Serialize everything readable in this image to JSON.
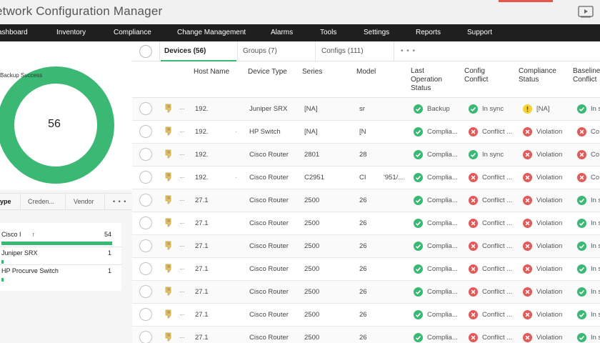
{
  "app": {
    "title": "etwork Configuration Manager",
    "accent": "#3bb873"
  },
  "nav": [
    "ashboard",
    "Inventory",
    "Compliance",
    "Change Management",
    "Alarms",
    "Tools",
    "Settings",
    "Reports",
    "Support"
  ],
  "donut": {
    "legend": "Backup Success",
    "value": "56",
    "color": "#3bb873"
  },
  "left_tabs": [
    "ype",
    "Creden...",
    "Vendor",
    "• • •"
  ],
  "vendors": [
    {
      "name": "Cisco I",
      "suffix": "r",
      "count": "54",
      "share": 1.0
    },
    {
      "name": "Juniper SRX",
      "count": "1",
      "share": 0.02
    },
    {
      "name": "HP Procurve Switch",
      "count": "1",
      "share": 0.02
    }
  ],
  "tabs": [
    {
      "label": "Devices (56)"
    },
    {
      "label": "Groups (7)"
    },
    {
      "label": "Configs (111)"
    },
    {
      "label": "• • •"
    }
  ],
  "columns": {
    "host": "Host Name",
    "device_type": "Device Type",
    "series": "Series",
    "model": "Model",
    "last_op_1": "Last",
    "last_op_2": "Operation",
    "last_op_3": "Status",
    "config_1": "Config",
    "config_2": "Conflict",
    "compliance_1": "Compliance",
    "compliance_2": "Status",
    "baseline_1": "Baseline",
    "baseline_2": "Conflict"
  },
  "rows": [
    {
      "dots": "...",
      "host": "192.",
      "extra": "",
      "type": "Juniper SRX",
      "series": "[NA]",
      "model": "sr",
      "model_extra": "",
      "op": {
        "s": "ok",
        "t": "Backup"
      },
      "conf": {
        "s": "ok",
        "t": "In sync"
      },
      "comp": {
        "s": "warn",
        "t": "[NA]"
      },
      "base": {
        "s": "ok",
        "t": "In s"
      }
    },
    {
      "dots": "...",
      "host": "192.",
      "extra": "·",
      "type": "HP Switch",
      "series": "[NA]",
      "model": "[N",
      "model_extra": "",
      "op": {
        "s": "ok",
        "t": "Complia..."
      },
      "conf": {
        "s": "bad",
        "t": "Conflict ..."
      },
      "comp": {
        "s": "bad",
        "t": "Violation"
      },
      "base": {
        "s": "bad",
        "t": "Co"
      }
    },
    {
      "dots": "...",
      "host": "192.",
      "extra": "",
      "type": "Cisco Router",
      "series": "2801",
      "model": "28",
      "model_extra": "",
      "op": {
        "s": "ok",
        "t": "Complia..."
      },
      "conf": {
        "s": "ok",
        "t": "In sync"
      },
      "comp": {
        "s": "bad",
        "t": "Violation"
      },
      "base": {
        "s": "bad",
        "t": "Co"
      }
    },
    {
      "dots": "...",
      "host": "192.",
      "extra": "·",
      "type": "Cisco Router",
      "series": "C2951",
      "model": "CI",
      "model_extra": "'951/...",
      "op": {
        "s": "ok",
        "t": "Complia..."
      },
      "conf": {
        "s": "bad",
        "t": "Conflict ..."
      },
      "comp": {
        "s": "bad",
        "t": "Violation"
      },
      "base": {
        "s": "bad",
        "t": "Co"
      }
    },
    {
      "dots": "...",
      "host": "27.1",
      "extra": "",
      "type": "Cisco Router",
      "series": "2500",
      "model": "26",
      "model_extra": "",
      "op": {
        "s": "ok",
        "t": "Complia..."
      },
      "conf": {
        "s": "bad",
        "t": "Conflict ..."
      },
      "comp": {
        "s": "bad",
        "t": "Violation"
      },
      "base": {
        "s": "ok",
        "t": "In s"
      }
    },
    {
      "dots": "...",
      "host": "27.1",
      "extra": "",
      "type": "Cisco Router",
      "series": "2500",
      "model": "26",
      "model_extra": "",
      "op": {
        "s": "ok",
        "t": "Complia..."
      },
      "conf": {
        "s": "bad",
        "t": "Conflict ..."
      },
      "comp": {
        "s": "bad",
        "t": "Violation"
      },
      "base": {
        "s": "ok",
        "t": "In s"
      }
    },
    {
      "dots": "...",
      "host": "27.1",
      "extra": "",
      "type": "Cisco Router",
      "series": "2500",
      "model": "26",
      "model_extra": "",
      "op": {
        "s": "ok",
        "t": "Complia..."
      },
      "conf": {
        "s": "bad",
        "t": "Conflict ..."
      },
      "comp": {
        "s": "bad",
        "t": "Violation"
      },
      "base": {
        "s": "ok",
        "t": "In s"
      }
    },
    {
      "dots": "...",
      "host": "27.1",
      "extra": "",
      "type": "Cisco Router",
      "series": "2500",
      "model": "26",
      "model_extra": "",
      "op": {
        "s": "ok",
        "t": "Complia..."
      },
      "conf": {
        "s": "bad",
        "t": "Conflict ..."
      },
      "comp": {
        "s": "bad",
        "t": "Violation"
      },
      "base": {
        "s": "ok",
        "t": "In s"
      }
    },
    {
      "dots": "...",
      "host": "27.1",
      "extra": "",
      "type": "Cisco Router",
      "series": "2500",
      "model": "26",
      "model_extra": "",
      "op": {
        "s": "ok",
        "t": "Complia..."
      },
      "conf": {
        "s": "bad",
        "t": "Conflict ..."
      },
      "comp": {
        "s": "bad",
        "t": "Violation"
      },
      "base": {
        "s": "ok",
        "t": "In s"
      }
    },
    {
      "dots": "...",
      "host": "27.1",
      "extra": "",
      "type": "Cisco Router",
      "series": "2500",
      "model": "26",
      "model_extra": "",
      "op": {
        "s": "ok",
        "t": "Complia..."
      },
      "conf": {
        "s": "bad",
        "t": "Conflict ..."
      },
      "comp": {
        "s": "bad",
        "t": "Violation"
      },
      "base": {
        "s": "ok",
        "t": "In s"
      }
    },
    {
      "dots": "...",
      "host": "27.1",
      "extra": "",
      "type": "Cisco Router",
      "series": "2500",
      "model": "26",
      "model_extra": "",
      "op": {
        "s": "ok",
        "t": "Complia..."
      },
      "conf": {
        "s": "bad",
        "t": "Conflict ..."
      },
      "comp": {
        "s": "bad",
        "t": "Violation"
      },
      "base": {
        "s": "ok",
        "t": "In s"
      }
    }
  ],
  "icons": {
    "row_icon": "device-tag-icon",
    "play_icon": "video-play-icon"
  }
}
